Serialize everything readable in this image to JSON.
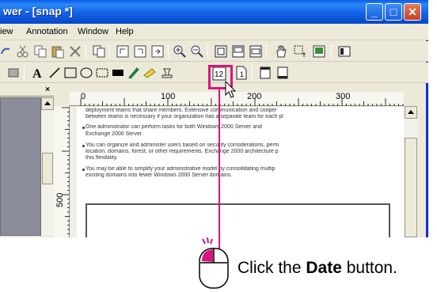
{
  "window": {
    "title": "wer - [snap *]",
    "controls": {
      "minimize": "_",
      "maximize": "□",
      "close": "X"
    }
  },
  "menubar": [
    "iew",
    "Annotation",
    "Window",
    "Help"
  ],
  "panel": {
    "close": "×"
  },
  "ruler": {
    "top_labels": [
      "0",
      "100",
      "200",
      "300"
    ],
    "left_label": "500"
  },
  "document": {
    "bullets": [
      "deployment teams that share members. Extensive communication and cooper",
      "between teams is necessary if your organization has a separate team for each pl",
      "One administrator can perform tasks for both Windows 2000 Server and",
      "Exchange 2000 Server.",
      "You can organize and administer users based on security considerations, perm",
      "location, domains, forest, or other requirements. Exchange 2000 architecture p",
      "this flexibility.",
      "You may be able to simplify your administrative model by consolidating multip",
      "existing domains into fewer Windows 2000 Server domains."
    ]
  },
  "toolbar": {
    "date_button": "12"
  },
  "instruction": {
    "prefix": "Click the ",
    "target": "Date",
    "suffix": " button."
  },
  "colors": {
    "highlight": "#d6157f",
    "titlebar": "#0a5be6"
  }
}
